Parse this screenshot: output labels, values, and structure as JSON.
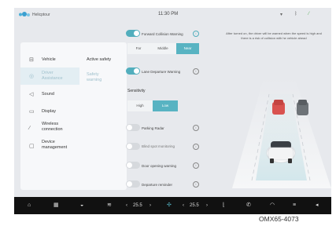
{
  "status_bar": {
    "app_name": "Helicptour",
    "time": "11:30 PM"
  },
  "sidebar": {
    "items": [
      {
        "label": "Vehicle",
        "icon": "car-icon"
      },
      {
        "label": "Driver Assistance",
        "icon": "steering-assist-icon",
        "active": true
      },
      {
        "label": "Sound",
        "icon": "speaker-icon"
      },
      {
        "label": "Display",
        "icon": "display-icon"
      },
      {
        "label": "Wireless connection",
        "icon": "wireless-icon"
      },
      {
        "label": "Device management",
        "icon": "device-icon"
      }
    ],
    "sub_items": [
      {
        "label": "Active safety"
      },
      {
        "label": "Safety warning",
        "active": true
      }
    ]
  },
  "settings": {
    "forward_collision": {
      "label": "Forward Collision Warning",
      "on": true
    },
    "distance_options": [
      "Far",
      "Middle",
      "Near"
    ],
    "distance_selected": "Near",
    "lane_departure": {
      "label": "Lane Departure Warning",
      "on": true
    },
    "sensitivity": {
      "label": "Sensitivity",
      "options": [
        "High",
        "Low"
      ],
      "selected": "Low"
    },
    "parking_radar": {
      "label": "Parking Radar",
      "on": false
    },
    "blind_spot": {
      "label": "Blind spot monitoring",
      "on": false
    },
    "door_opening": {
      "label": "Door opening warning",
      "on": false
    },
    "departure_reminder": {
      "label": "Departure reminder",
      "on": false
    }
  },
  "tooltip": "After turned on, the driver will be warned when the speed is high and there is a risk of collision with he vehicle ahead",
  "dock": {
    "temp_left": "25.5",
    "temp_right": "25.5"
  },
  "caption": "OMX65-4073",
  "colors": {
    "accent": "#52aebd",
    "car_front": "#d9524f",
    "dock_bg": "#111111"
  }
}
